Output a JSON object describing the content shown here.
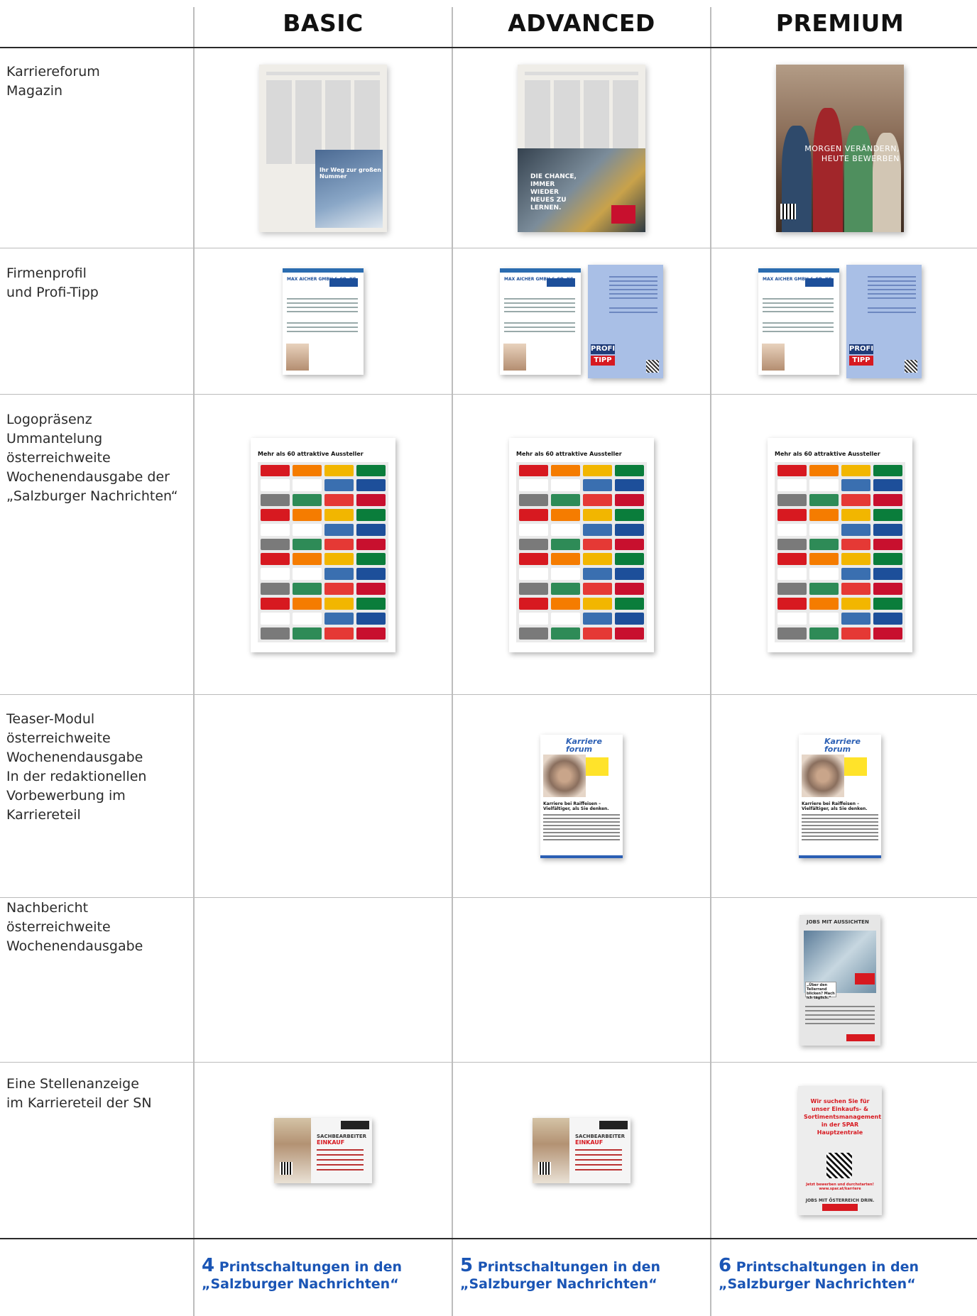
{
  "header": {
    "tiers": [
      "BASIC",
      "ADVANCED",
      "PREMIUM"
    ]
  },
  "rows": [
    {
      "label": "Karriereforum\nMagazin"
    },
    {
      "label": "Firmenprofil\nund Profi-Tipp"
    },
    {
      "label": "Logopräsenz\nUmmantelung\nösterreichweite\nWochenendausgabe der\n„Salzburger Nachrichten“"
    },
    {
      "label": "Teaser-Modul\nösterreichweite\nWochenendausgabe\nIn der redaktionellen\nVorbewerbung im\nKarriereteil"
    },
    {
      "label": "Nachbericht\nösterreichweite\nWochenendausgabe"
    },
    {
      "label": "Eine Stellenanzeige\nim Karriereteil der SN"
    }
  ],
  "thumbs": {
    "magazine_basic_ad": "Ihr Weg zur großen Nummer",
    "magazine_adv_ad": "DIE CHANCE, IMMER WIEDER NEUES ZU LERNEN.",
    "magazine_premium_cover": "MORGEN VERÄNDERN, HEUTE BEWERBEN",
    "profile_company": "MAX AICHER GMBH & CO. KG",
    "tipp_label_1": "PROFI",
    "tipp_label_2": "TIPP",
    "logos_title": "Mehr als 60 attraktive Aussteller",
    "teaser_logo": "Karriere forum",
    "teaser_headline": "Karriere bei Raiffeisen – Vielfältiger, als Sie denken.",
    "report_header": "JOBS MIT AUSSICHTEN",
    "report_bubble": "„Über den Tellerrand blicken? Mach ich täglich.“",
    "ad_title_1": "SACHBEARBEITER",
    "ad_title_2": "EINKAUF",
    "spar_text": "Wir suchen Sie für\nunser Einkaufs- &\nSortimentsmanagement\nin der SPAR\nHauptzentrale",
    "spar_cta": "Jetzt bewerben und durchstarten!\nwww.spar.at/karriere",
    "spar_jobs": "JOBS MIT ÖSTERREICH DRIN."
  },
  "footer": [
    {
      "num": "4",
      "text1": "Printschaltungen in den",
      "text2": "„Salzburger Nachrichten“"
    },
    {
      "num": "5",
      "text1": "Printschaltungen in den",
      "text2": "„Salzburger Nachrichten“"
    },
    {
      "num": "6",
      "text1": "Printschaltungen in den",
      "text2": "„Salzburger Nachrichten“"
    }
  ],
  "colors": {
    "accent_blue": "#1a55b5",
    "spar_red": "#d71920"
  }
}
